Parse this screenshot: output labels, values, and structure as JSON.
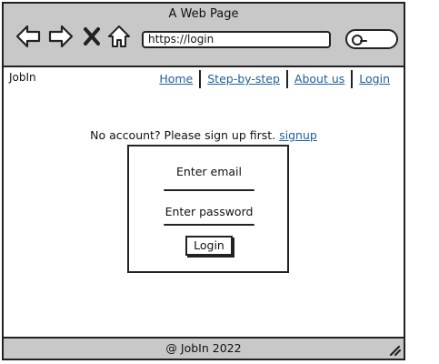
{
  "window": {
    "title": "A Web Page",
    "address": "https://login"
  },
  "site": {
    "brand": "JobIn",
    "nav": [
      {
        "label": "Home"
      },
      {
        "label": "Step-by-step"
      },
      {
        "label": "About us"
      },
      {
        "label": "Login"
      }
    ]
  },
  "login": {
    "signup_prompt": "No account? Please sign up first.",
    "signup_link": "signup",
    "email_placeholder": "Enter email",
    "password_placeholder": "Enter password",
    "button_label": "Login"
  },
  "footer": {
    "text": "@ JobIn 2022"
  },
  "icons": {
    "back": "arrow-left-icon",
    "forward": "arrow-right-icon",
    "stop": "close-icon",
    "home": "home-icon",
    "search": "search-icon",
    "resize": "resize-grip-icon"
  },
  "colors": {
    "chrome": "#c8c8c8",
    "link": "#1f5fa0",
    "border": "#222222"
  }
}
